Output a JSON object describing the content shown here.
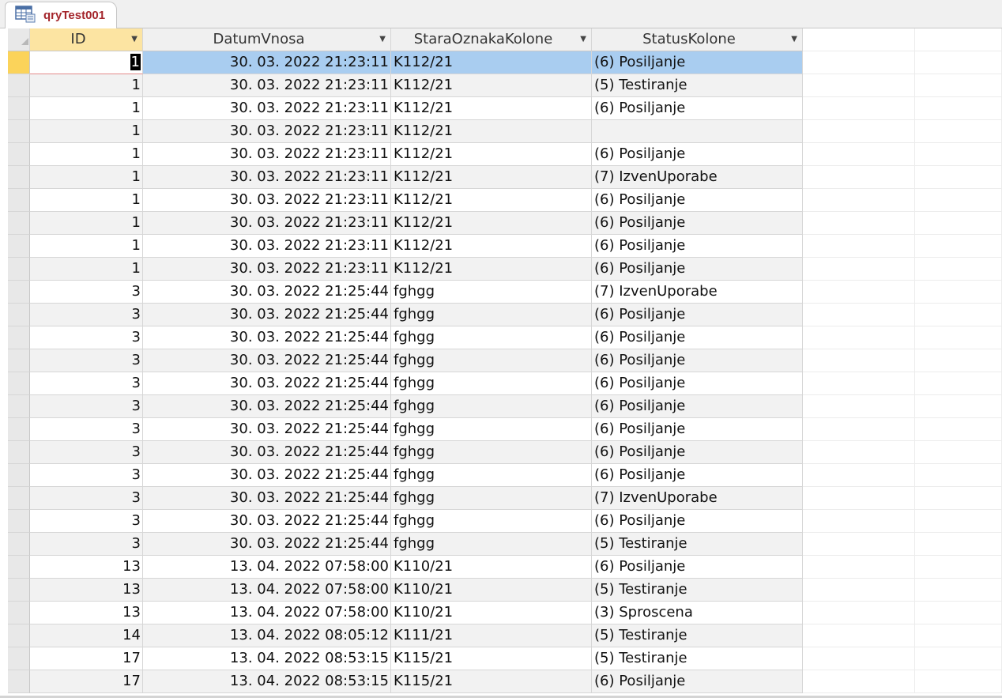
{
  "tab": {
    "title": "qryTest001",
    "icon": "query-datasheet-icon"
  },
  "columns": {
    "id": "ID",
    "datum": "DatumVnosa",
    "oznaka": "StaraOznakaKolone",
    "status": "StatusKolone"
  },
  "current_row": 0,
  "rows": [
    {
      "id": "1",
      "datum": "30. 03. 2022 21:23:11",
      "oznaka": "K112/21",
      "status": "(6) Posiljanje"
    },
    {
      "id": "1",
      "datum": "30. 03. 2022 21:23:11",
      "oznaka": "K112/21",
      "status": "(5) Testiranje"
    },
    {
      "id": "1",
      "datum": "30. 03. 2022 21:23:11",
      "oznaka": "K112/21",
      "status": "(6) Posiljanje"
    },
    {
      "id": "1",
      "datum": "30. 03. 2022 21:23:11",
      "oznaka": "K112/21",
      "status": ""
    },
    {
      "id": "1",
      "datum": "30. 03. 2022 21:23:11",
      "oznaka": "K112/21",
      "status": "(6) Posiljanje"
    },
    {
      "id": "1",
      "datum": "30. 03. 2022 21:23:11",
      "oznaka": "K112/21",
      "status": "(7) IzvenUporabe"
    },
    {
      "id": "1",
      "datum": "30. 03. 2022 21:23:11",
      "oznaka": "K112/21",
      "status": "(6) Posiljanje"
    },
    {
      "id": "1",
      "datum": "30. 03. 2022 21:23:11",
      "oznaka": "K112/21",
      "status": "(6) Posiljanje"
    },
    {
      "id": "1",
      "datum": "30. 03. 2022 21:23:11",
      "oznaka": "K112/21",
      "status": "(6) Posiljanje"
    },
    {
      "id": "1",
      "datum": "30. 03. 2022 21:23:11",
      "oznaka": "K112/21",
      "status": "(6) Posiljanje"
    },
    {
      "id": "3",
      "datum": "30. 03. 2022 21:25:44",
      "oznaka": "fghgg",
      "status": "(7) IzvenUporabe"
    },
    {
      "id": "3",
      "datum": "30. 03. 2022 21:25:44",
      "oznaka": "fghgg",
      "status": "(6) Posiljanje"
    },
    {
      "id": "3",
      "datum": "30. 03. 2022 21:25:44",
      "oznaka": "fghgg",
      "status": "(6) Posiljanje"
    },
    {
      "id": "3",
      "datum": "30. 03. 2022 21:25:44",
      "oznaka": "fghgg",
      "status": "(6) Posiljanje"
    },
    {
      "id": "3",
      "datum": "30. 03. 2022 21:25:44",
      "oznaka": "fghgg",
      "status": "(6) Posiljanje"
    },
    {
      "id": "3",
      "datum": "30. 03. 2022 21:25:44",
      "oznaka": "fghgg",
      "status": "(6) Posiljanje"
    },
    {
      "id": "3",
      "datum": "30. 03. 2022 21:25:44",
      "oznaka": "fghgg",
      "status": "(6) Posiljanje"
    },
    {
      "id": "3",
      "datum": "30. 03. 2022 21:25:44",
      "oznaka": "fghgg",
      "status": "(6) Posiljanje"
    },
    {
      "id": "3",
      "datum": "30. 03. 2022 21:25:44",
      "oznaka": "fghgg",
      "status": "(6) Posiljanje"
    },
    {
      "id": "3",
      "datum": "30. 03. 2022 21:25:44",
      "oznaka": "fghgg",
      "status": "(7) IzvenUporabe"
    },
    {
      "id": "3",
      "datum": "30. 03. 2022 21:25:44",
      "oznaka": "fghgg",
      "status": "(6) Posiljanje"
    },
    {
      "id": "3",
      "datum": "30. 03. 2022 21:25:44",
      "oznaka": "fghgg",
      "status": "(5) Testiranje"
    },
    {
      "id": "13",
      "datum": "13. 04. 2022 07:58:00",
      "oznaka": "K110/21",
      "status": "(6) Posiljanje"
    },
    {
      "id": "13",
      "datum": "13. 04. 2022 07:58:00",
      "oznaka": "K110/21",
      "status": "(5) Testiranje"
    },
    {
      "id": "13",
      "datum": "13. 04. 2022 07:58:00",
      "oznaka": "K110/21",
      "status": "(3) Sproscena"
    },
    {
      "id": "14",
      "datum": "13. 04. 2022 08:05:12",
      "oznaka": "K111/21",
      "status": "(5) Testiranje"
    },
    {
      "id": "17",
      "datum": "13. 04. 2022 08:53:15",
      "oznaka": "K115/21",
      "status": "(5) Testiranje"
    },
    {
      "id": "17",
      "datum": "13. 04. 2022 08:53:15",
      "oznaka": "K115/21",
      "status": "(6) Posiljanje"
    }
  ]
}
